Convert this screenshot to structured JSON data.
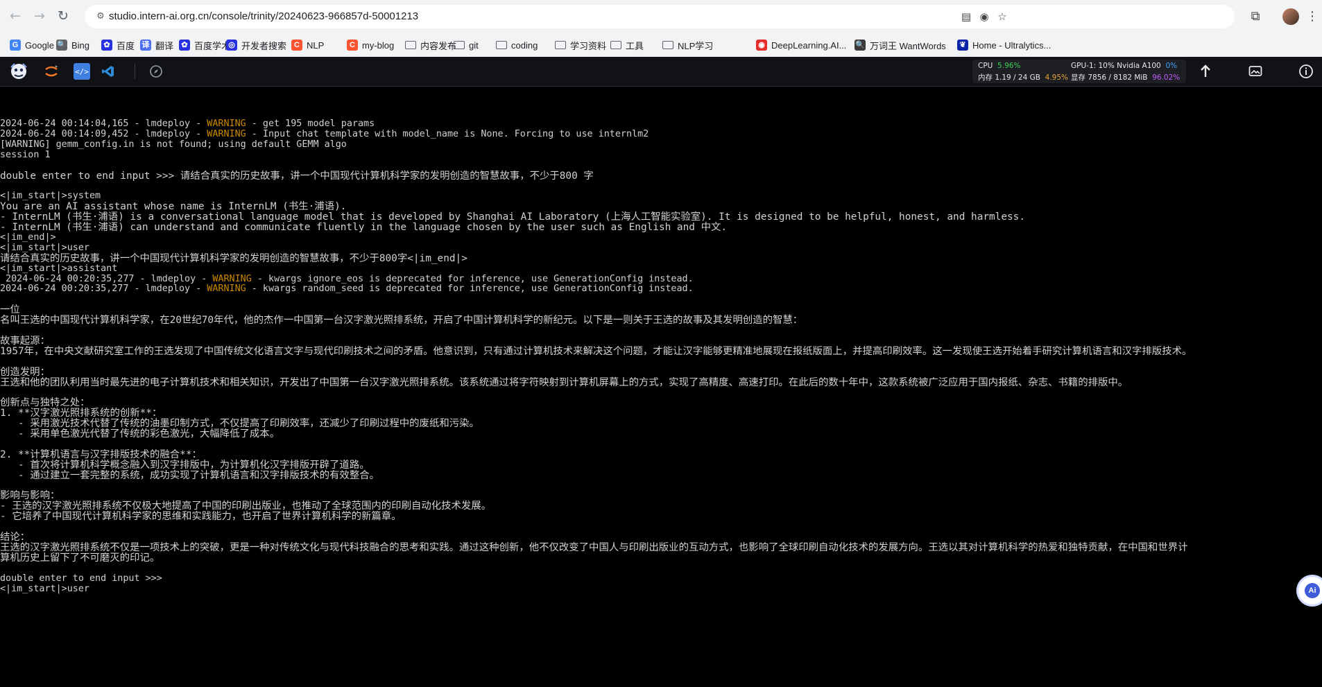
{
  "browser": {
    "url": "studio.intern-ai.org.cn/console/trinity/20240623-966857d-50001213",
    "nav": {
      "back": "←",
      "forward": "→",
      "reload": "↻"
    },
    "bookmarks": [
      {
        "label": "Google",
        "icon": "google-icon",
        "color": "#4285f4",
        "glyph": "G"
      },
      {
        "label": "Bing",
        "icon": "bing-icon",
        "color": "#5f6368",
        "glyph": "🔍"
      },
      {
        "label": "百度",
        "icon": "baidu-paw-icon",
        "color": "#2932e1",
        "glyph": "✿"
      },
      {
        "label": "翻译",
        "icon": "translate-icon",
        "color": "#4e6ef2",
        "glyph": "译"
      },
      {
        "label": "百度学术",
        "icon": "baidu-scholar-icon",
        "color": "#2932e1",
        "glyph": "✿"
      },
      {
        "label": "开发者搜索",
        "icon": "developer-search-icon",
        "color": "#2932e1",
        "glyph": "◎"
      },
      {
        "label": "NLP",
        "icon": "csdn-icon",
        "color": "#fc5531",
        "glyph": "C"
      },
      {
        "label": "my-blog",
        "icon": "csdn-icon",
        "color": "#fc5531",
        "glyph": "C"
      },
      {
        "label": "内容发布",
        "icon": "folder-icon",
        "color": "",
        "glyph": ""
      },
      {
        "label": "git",
        "icon": "folder-icon",
        "color": "",
        "glyph": ""
      },
      {
        "label": "coding",
        "icon": "folder-icon",
        "color": "",
        "glyph": ""
      },
      {
        "label": "学习资料",
        "icon": "folder-icon",
        "color": "",
        "glyph": ""
      },
      {
        "label": "工具",
        "icon": "folder-icon",
        "color": "",
        "glyph": ""
      },
      {
        "label": "NLP学习",
        "icon": "folder-icon",
        "color": "",
        "glyph": ""
      },
      {
        "label": "DeepLearning.AI...",
        "icon": "deeplearning-ai-icon",
        "color": "#e62b2b",
        "glyph": "◉"
      },
      {
        "label": "万词王 WantWords",
        "icon": "wantwords-icon",
        "color": "#3a3a3a",
        "glyph": "🔍"
      },
      {
        "label": "Home - Ultralytics...",
        "icon": "ultralytics-icon",
        "color": "#0b23a9",
        "glyph": "❦"
      }
    ]
  },
  "monitor": {
    "cpu_label": "CPU",
    "cpu_value": "5.96%",
    "mem_label": "内存 1.19 / 24 GB",
    "mem_value": "4.95%",
    "gpu_label": "GPU-1: 10% Nvidia A100",
    "gpu_value": "0%",
    "vram_label": "显存 7856 / 8182 MiB",
    "vram_value": "96.02%"
  },
  "terminal": {
    "lines": [
      {
        "kind": "log",
        "pre": "2024-06-24 00:14:04,165 - lmdeploy - ",
        "level": "WARNING",
        "post": " - get 195 model params"
      },
      {
        "kind": "log",
        "pre": "2024-06-24 00:14:09,452 - lmdeploy - ",
        "level": "WARNING",
        "post": " - Input chat template with model_name is None. Forcing to use internlm2"
      },
      {
        "kind": "text",
        "text": "[WARNING] gemm_config.in is not found; using default GEMM algo"
      },
      {
        "kind": "text",
        "text": "session 1"
      },
      {
        "kind": "blank"
      },
      {
        "kind": "text",
        "text": "double enter to end input >>> 请结合真实的历史故事，讲一个中国现代计算机科学家的发明创造的智慧故事，不少于800 字"
      },
      {
        "kind": "blank"
      },
      {
        "kind": "text",
        "text": "<|im_start|>system"
      },
      {
        "kind": "text",
        "text": "You are an AI assistant whose name is InternLM (书生·浦语)."
      },
      {
        "kind": "text",
        "text": "- InternLM (书生·浦语) is a conversational language model that is developed by Shanghai AI Laboratory (上海人工智能实验室). It is designed to be helpful, honest, and harmless."
      },
      {
        "kind": "text",
        "text": "- InternLM (书生·浦语) can understand and communicate fluently in the language chosen by the user such as English and 中文."
      },
      {
        "kind": "text",
        "text": "<|im_end|>"
      },
      {
        "kind": "text",
        "text": "<|im_start|>user"
      },
      {
        "kind": "text",
        "text": "请结合真实的历史故事，讲一个中国现代计算机科学家的发明创造的智慧故事，不少于800字<|im_end|>"
      },
      {
        "kind": "text",
        "text": "<|im_start|>assistant"
      },
      {
        "kind": "log",
        "pre": " 2024-06-24 00:20:35,277 - lmdeploy - ",
        "level": "WARNING",
        "post": " - kwargs ignore_eos is deprecated for inference, use GenerationConfig instead."
      },
      {
        "kind": "log",
        "pre": "2024-06-24 00:20:35,277 - lmdeploy - ",
        "level": "WARNING",
        "post": " - kwargs random_seed is deprecated for inference, use GenerationConfig instead."
      },
      {
        "kind": "blank"
      },
      {
        "kind": "text",
        "text": "一位"
      },
      {
        "kind": "text",
        "text": "名叫王选的中国现代计算机科学家，在20世纪70年代，他的杰作一中国第一台汉字激光照排系统，开启了中国计算机科学的新纪元。以下是一则关于王选的故事及其发明创造的智慧："
      },
      {
        "kind": "blank"
      },
      {
        "kind": "text",
        "text": "故事起源："
      },
      {
        "kind": "text",
        "text": "1957年，在中央文献研究室工作的王选发现了中国传统文化语言文字与现代印刷技术之间的矛盾。他意识到，只有通过计算机技术来解决这个问题，才能让汉字能够更精准地展现在报纸版面上，并提高印刷效率。这一发现使王选开始着手研究计算机语言和汉字排版技术。"
      },
      {
        "kind": "blank"
      },
      {
        "kind": "text",
        "text": "创造发明："
      },
      {
        "kind": "text",
        "text": "王选和他的团队利用当时最先进的电子计算机技术和相关知识，开发出了中国第一台汉字激光照排系统。该系统通过将字符映射到计算机屏幕上的方式，实现了高精度、高速打印。在此后的数十年中，这款系统被广泛应用于国内报纸、杂志、书籍的排版中。"
      },
      {
        "kind": "blank"
      },
      {
        "kind": "text",
        "text": "创新点与独特之处："
      },
      {
        "kind": "text",
        "text": "1. **汉字激光照排系统的创新**："
      },
      {
        "kind": "text",
        "text": "   - 采用激光技术代替了传统的油墨印制方式，不仅提高了印刷效率，还减少了印刷过程中的废纸和污染。"
      },
      {
        "kind": "text",
        "text": "   - 采用单色激光代替了传统的彩色激光，大幅降低了成本。"
      },
      {
        "kind": "blank"
      },
      {
        "kind": "text",
        "text": "2. **计算机语言与汉字排版技术的融合**："
      },
      {
        "kind": "text",
        "text": "   - 首次将计算机科学概念融入到汉字排版中，为计算机化汉字排版开辟了道路。"
      },
      {
        "kind": "text",
        "text": "   - 通过建立一套完整的系统，成功实现了计算机语言和汉字排版技术的有效整合。"
      },
      {
        "kind": "blank"
      },
      {
        "kind": "text",
        "text": "影响与影响："
      },
      {
        "kind": "text",
        "text": "- 王选的汉字激光照排系统不仅极大地提高了中国的印刷出版业，也推动了全球范围内的印刷自动化技术发展。"
      },
      {
        "kind": "text",
        "text": "- 它培养了中国现代计算机科学家的思维和实践能力，也开启了世界计算机科学的新篇章。"
      },
      {
        "kind": "blank"
      },
      {
        "kind": "text",
        "text": "结论："
      },
      {
        "kind": "text",
        "text": "王选的汉字激光照排系统不仅是一项技术上的突破，更是一种对传统文化与现代科技融合的思考和实践。通过这种创新，他不仅改变了中国人与印刷出版业的互动方式，也影响了全球印刷自动化技术的发展方向。王选以其对计算机科学的热爱和独特贡献，在中国和世界计"
      },
      {
        "kind": "text",
        "text": "算机历史上留下了不可磨灭的印记。"
      },
      {
        "kind": "blank"
      },
      {
        "kind": "text",
        "text": "double enter to end input >>>"
      },
      {
        "kind": "text",
        "text": "<|im_start|>user"
      }
    ]
  },
  "fab": {
    "label": "Ai"
  },
  "colors": {
    "warning": "#cc8800",
    "terminal_bg": "#000000",
    "terminal_fg": "#d2d2d2"
  }
}
